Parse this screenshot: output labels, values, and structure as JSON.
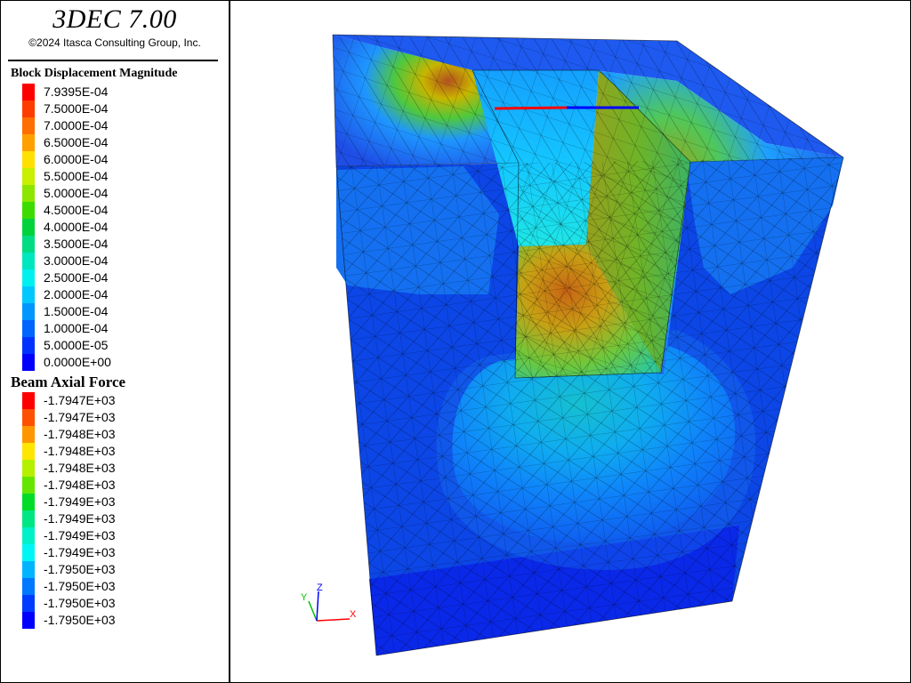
{
  "app": {
    "title": "3DEC 7.00",
    "copyright": "©2024 Itasca Consulting Group, Inc."
  },
  "legend_displacement": {
    "title": "Block  Displacement Magnitude",
    "entries": [
      {
        "label": "7.9395E-04",
        "color": "#ff0000"
      },
      {
        "label": "7.5000E-04",
        "color": "#ff3c00"
      },
      {
        "label": "7.0000E-04",
        "color": "#ff6e00"
      },
      {
        "label": "6.5000E-04",
        "color": "#ffa000"
      },
      {
        "label": "6.0000E-04",
        "color": "#ffe000"
      },
      {
        "label": "5.5000E-04",
        "color": "#c8f000"
      },
      {
        "label": "5.0000E-04",
        "color": "#8ce600"
      },
      {
        "label": "4.5000E-04",
        "color": "#3cdc00"
      },
      {
        "label": "4.0000E-04",
        "color": "#00d23c"
      },
      {
        "label": "3.5000E-04",
        "color": "#00dc82"
      },
      {
        "label": "3.0000E-04",
        "color": "#00e6be"
      },
      {
        "label": "2.5000E-04",
        "color": "#00f0f0"
      },
      {
        "label": "2.0000E-04",
        "color": "#00c8ff"
      },
      {
        "label": "1.5000E-04",
        "color": "#0096ff"
      },
      {
        "label": "1.0000E-04",
        "color": "#0064ff"
      },
      {
        "label": "5.0000E-05",
        "color": "#0032ff"
      },
      {
        "label": "0.0000E+00",
        "color": "#0000ff"
      }
    ]
  },
  "legend_beam": {
    "title": "Beam Axial Force",
    "entries": [
      {
        "label": "-1.7947E+03",
        "color": "#ff0000"
      },
      {
        "label": "-1.7947E+03",
        "color": "#ff5000"
      },
      {
        "label": "-1.7948E+03",
        "color": "#ff9600"
      },
      {
        "label": "-1.7948E+03",
        "color": "#ffe600"
      },
      {
        "label": "-1.7948E+03",
        "color": "#b4f000"
      },
      {
        "label": "-1.7948E+03",
        "color": "#64e600"
      },
      {
        "label": "-1.7949E+03",
        "color": "#00dc28"
      },
      {
        "label": "-1.7949E+03",
        "color": "#00e682"
      },
      {
        "label": "-1.7949E+03",
        "color": "#00f0c8"
      },
      {
        "label": "-1.7949E+03",
        "color": "#00f5f5"
      },
      {
        "label": "-1.7950E+03",
        "color": "#00b4ff"
      },
      {
        "label": "-1.7950E+03",
        "color": "#0078ff"
      },
      {
        "label": "-1.7950E+03",
        "color": "#003cff"
      },
      {
        "label": "-1.7950E+03",
        "color": "#0000ff"
      }
    ]
  },
  "axes_triad": {
    "x_label": "X",
    "y_label": "Y",
    "z_label": "Z",
    "x_color": "#ff0000",
    "y_color": "#00c000",
    "z_color": "#0000ff"
  }
}
